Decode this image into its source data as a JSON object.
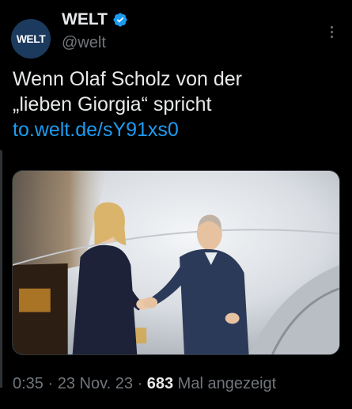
{
  "tweet": {
    "author": {
      "display_name": "WELT",
      "handle": "@welt",
      "avatar_text": "WELT",
      "verified": true
    },
    "text_line1": "Wenn Olaf Scholz von der",
    "text_line2": "„lieben Giorgia“ spricht",
    "link": "to.welt.de/sY91xs0",
    "meta": {
      "time": "0:35",
      "sep1": " · ",
      "date": "23 Nov. 23",
      "sep2": " · ",
      "views": "683",
      "views_label": " Mal angezeigt"
    }
  },
  "colors": {
    "background": "#000000",
    "text": "#e7e9ea",
    "muted": "#71767b",
    "link": "#1d9bf0",
    "avatar_bg": "#1c3a5e"
  },
  "icons": [
    "verified-badge-icon",
    "more-options-icon"
  ]
}
